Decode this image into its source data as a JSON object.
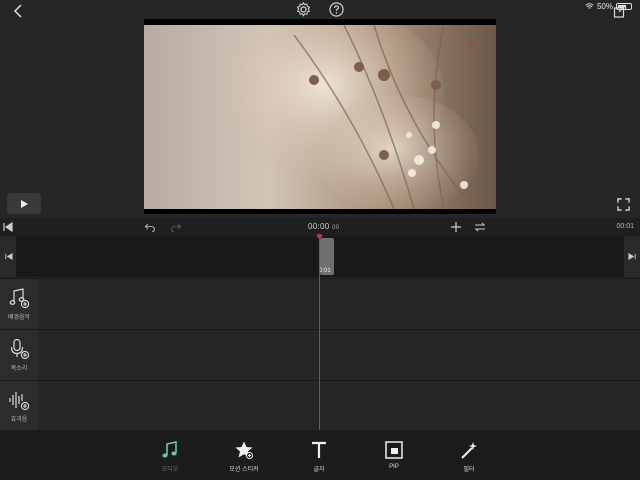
{
  "status_bar": {
    "battery": "50%"
  },
  "preview": {
    "timecode": "00:00",
    "timecode_frames": "00",
    "end_time": "00:01"
  },
  "timeline": {
    "clip_label": "0:01"
  },
  "tracks": [
    {
      "label": "배경음악",
      "icon": "music-add-icon"
    },
    {
      "label": "목소리",
      "icon": "mic-add-icon"
    },
    {
      "label": "효과음",
      "icon": "waveform-add-icon"
    }
  ],
  "toolbar": {
    "audio_label": "오디오",
    "sticker_label": "모션 스티커",
    "text_label": "글자",
    "pip_label": "PIP",
    "filter_label": "필터"
  },
  "colors": {
    "accent": "#6fc3a8",
    "playhead": "#c0392b"
  }
}
